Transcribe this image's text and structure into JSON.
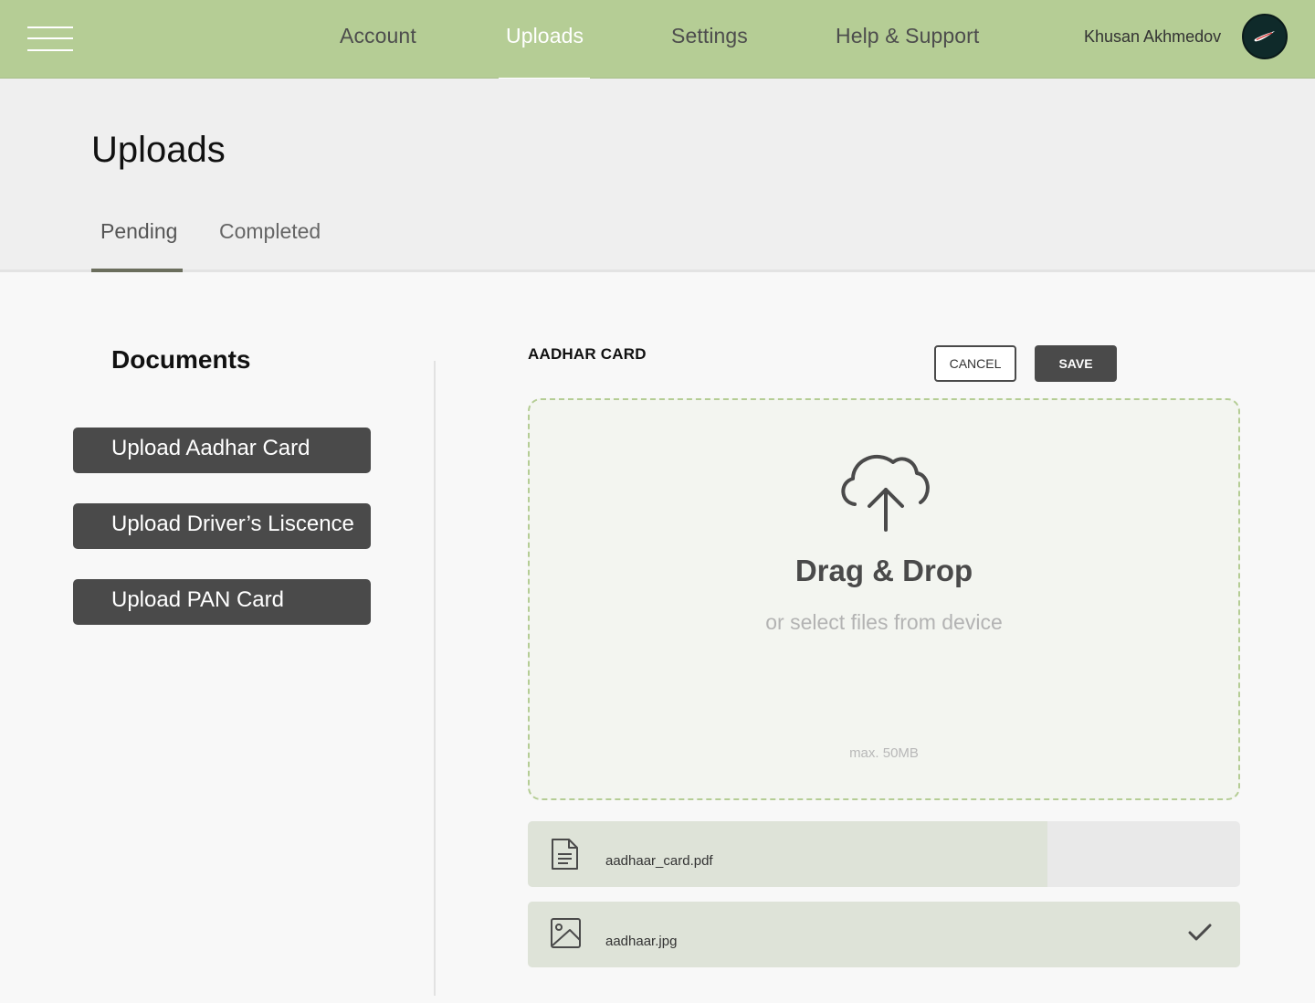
{
  "nav": {
    "items": [
      {
        "label": "Account",
        "active": false
      },
      {
        "label": "Uploads",
        "active": true
      },
      {
        "label": "Settings",
        "active": false
      },
      {
        "label": "Help & Support",
        "active": false
      }
    ],
    "username": "Khusan Akhmedov",
    "icons": {
      "menu": "hamburger-menu-icon",
      "avatar": "nike-swoosh-avatar"
    }
  },
  "page": {
    "title": "Uploads",
    "tabs": [
      {
        "label": "Pending",
        "active": true
      },
      {
        "label": "Completed",
        "active": false
      }
    ]
  },
  "documents": {
    "title": "Documents",
    "buttons": [
      "Upload Aadhar Card",
      "Upload Driver’s Liscence",
      "Upload PAN Card"
    ]
  },
  "panel": {
    "label": "AADHAR CARD",
    "cancel_label": "CANCEL",
    "save_label": "SAVE",
    "dropzone": {
      "icon": "cloud-upload-icon",
      "title": "Drag & Drop",
      "subtitle": "or select files from device",
      "max": "max. 50MB"
    },
    "files": [
      {
        "name": "aadhaar_card.pdf",
        "icon": "document-icon",
        "progress": 0.73,
        "complete": false
      },
      {
        "name": "aadhaar.jpg",
        "icon": "image-icon",
        "progress": 1.0,
        "complete": true
      }
    ]
  },
  "colors": {
    "header_bg": "#b5cd95",
    "dark_button": "#4a4a4a",
    "dropzone_border": "#b5cd95",
    "file_progress": "#dee3d8"
  }
}
